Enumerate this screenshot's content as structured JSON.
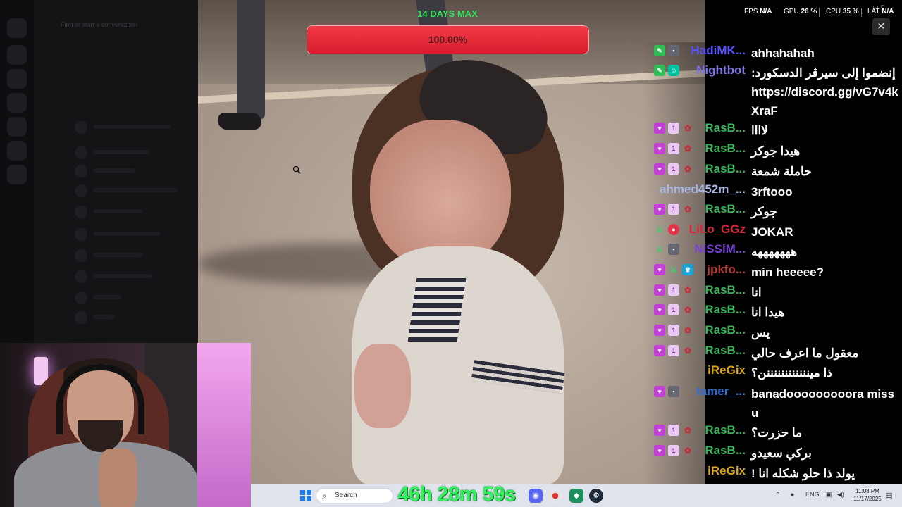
{
  "goal": {
    "title": "14 DAYS MAX",
    "progress_text": "100.00%",
    "progress_fraction": 1.0
  },
  "perf": {
    "fps_label": "FPS",
    "fps_value": "N/A",
    "gpu_label": "GPU",
    "gpu_value": "26 %",
    "cpu_label": "CPU",
    "cpu_value": "35 %",
    "lat_label": "LAT",
    "lat_value": "N/A"
  },
  "window": {
    "close_label": "✕",
    "controls": "▭ ▫"
  },
  "chat": {
    "messages": [
      {
        "user": "HadiMK...",
        "color": "#5a52ff",
        "badges": [
          "green",
          "gray"
        ],
        "text": "ahhahahah"
      },
      {
        "user": "Nightbot",
        "color": "#7b73e6",
        "badges": [
          "green",
          "bot"
        ],
        "text": "إنضموا إلى سيرڤر الدسكورد: https://discord.gg/vG7v4kXraF"
      },
      {
        "user": "RasB...",
        "color": "#3bb35a",
        "badges": [
          "heart",
          "sub",
          "rose"
        ],
        "text": "لاااا"
      },
      {
        "user": "RasB...",
        "color": "#3bb35a",
        "badges": [
          "heart",
          "sub",
          "rose"
        ],
        "text": "هيدا جوكر"
      },
      {
        "user": "RasB...",
        "color": "#3bb35a",
        "badges": [
          "heart",
          "sub",
          "rose"
        ],
        "text": "حاملة شمعة"
      },
      {
        "user": "ahmed452m_...",
        "color": "#a9b9e5",
        "badges": [],
        "text": "3rftooo"
      },
      {
        "user": "RasB...",
        "color": "#3bb35a",
        "badges": [
          "heart",
          "sub",
          "rose"
        ],
        "text": "جوكر"
      },
      {
        "user": "LiLo_GGz",
        "color": "#e0243a",
        "badges": [
          "mod",
          "red"
        ],
        "text": "JOKAR"
      },
      {
        "user": "NiSSiM...",
        "color": "#7a42d9",
        "badges": [
          "mod",
          "gray"
        ],
        "text": "هههههههه"
      },
      {
        "user": "jpkfo...",
        "color": "#b83a3a",
        "badges": [
          "heart",
          "mod",
          "crown"
        ],
        "text": "min heeeee?"
      },
      {
        "user": "RasB...",
        "color": "#3bb35a",
        "badges": [
          "heart",
          "sub",
          "rose"
        ],
        "text": "انا"
      },
      {
        "user": "RasB...",
        "color": "#3bb35a",
        "badges": [
          "heart",
          "sub",
          "rose"
        ],
        "text": "هيدا انا"
      },
      {
        "user": "RasB...",
        "color": "#3bb35a",
        "badges": [
          "heart",
          "sub",
          "rose"
        ],
        "text": "يس"
      },
      {
        "user": "RasB...",
        "color": "#3bb35a",
        "badges": [
          "heart",
          "sub",
          "rose"
        ],
        "text": "معقول ما اعرف حالي"
      },
      {
        "user": "iReGix",
        "color": "#d9a520",
        "badges": [],
        "text": "ذا ميننننننننننننن؟"
      },
      {
        "user": "tamer_...",
        "color": "#2e6fd6",
        "badges": [
          "heart",
          "gray"
        ],
        "text": "banadooooooooora miss u"
      },
      {
        "user": "RasB...",
        "color": "#3bb35a",
        "badges": [
          "heart",
          "sub",
          "rose"
        ],
        "text": "ما حزرت؟"
      },
      {
        "user": "RasB...",
        "color": "#3bb35a",
        "badges": [
          "heart",
          "sub",
          "rose"
        ],
        "text": "بركي سعيدو"
      },
      {
        "user": "iReGix",
        "color": "#d9a520",
        "badges": [],
        "text": "يولد ذا حلو شكله انا !"
      },
      {
        "user": "RasB...",
        "color": "#3bb35a",
        "badges": [
          "heart",
          "sub",
          "rose"
        ],
        "text": ""
      }
    ]
  },
  "taskbar": {
    "search_label": "Search",
    "timer": "46h 28m 59s",
    "lang": "ENG",
    "time": "11:08 PM",
    "date": "11/17/2025"
  },
  "background_app": {
    "conversation_placeholder": "Find or start a conversation"
  }
}
